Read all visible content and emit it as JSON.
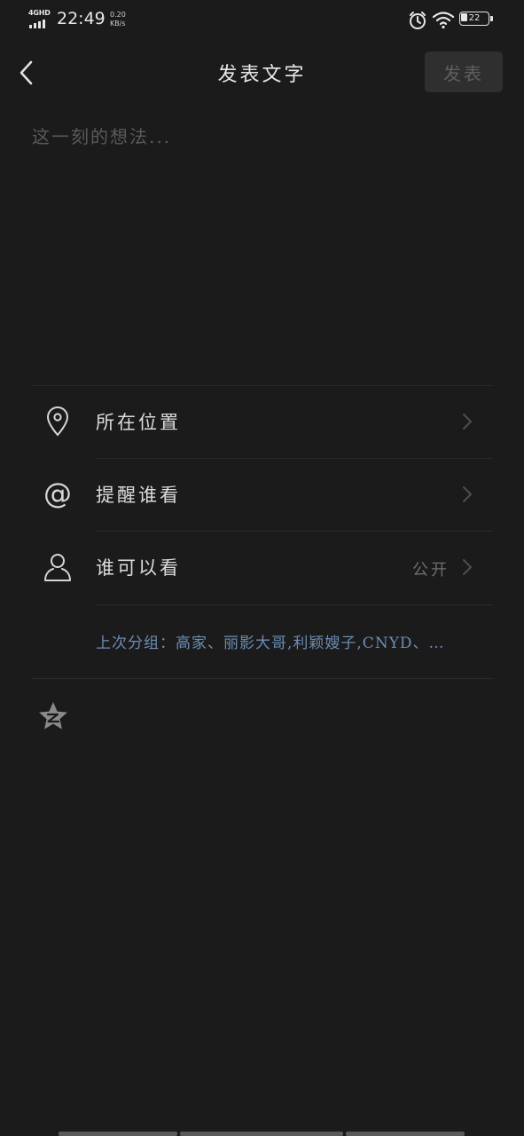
{
  "status_bar": {
    "network": "4GHD",
    "time": "22:49",
    "speed_value": "0.20",
    "speed_unit": "KB/s",
    "battery_level": "22",
    "icons": [
      "signal-icon",
      "alarm-icon",
      "wifi-icon",
      "battery-icon"
    ]
  },
  "header": {
    "title": "发表文字",
    "publish_label": "发表",
    "back_icon": "back-chevron-icon"
  },
  "composer": {
    "placeholder": "这一刻的想法...",
    "value": ""
  },
  "options": {
    "location": {
      "label": "所在位置",
      "icon": "location-pin-icon"
    },
    "remind": {
      "label": "提醒谁看",
      "icon": "at-icon"
    },
    "visibility": {
      "label": "谁可以看",
      "value": "公开",
      "icon": "person-icon"
    }
  },
  "last_group": {
    "label": "上次分组：",
    "names": "高家、丽影大哥,利颖嫂子,CNYD、…"
  },
  "extras": {
    "qzone_icon": "qzone-star-icon"
  },
  "colors": {
    "background": "#1b1b1b",
    "accent_link": "#6c8db5",
    "publish_disabled_bg": "#2f2f2f"
  }
}
